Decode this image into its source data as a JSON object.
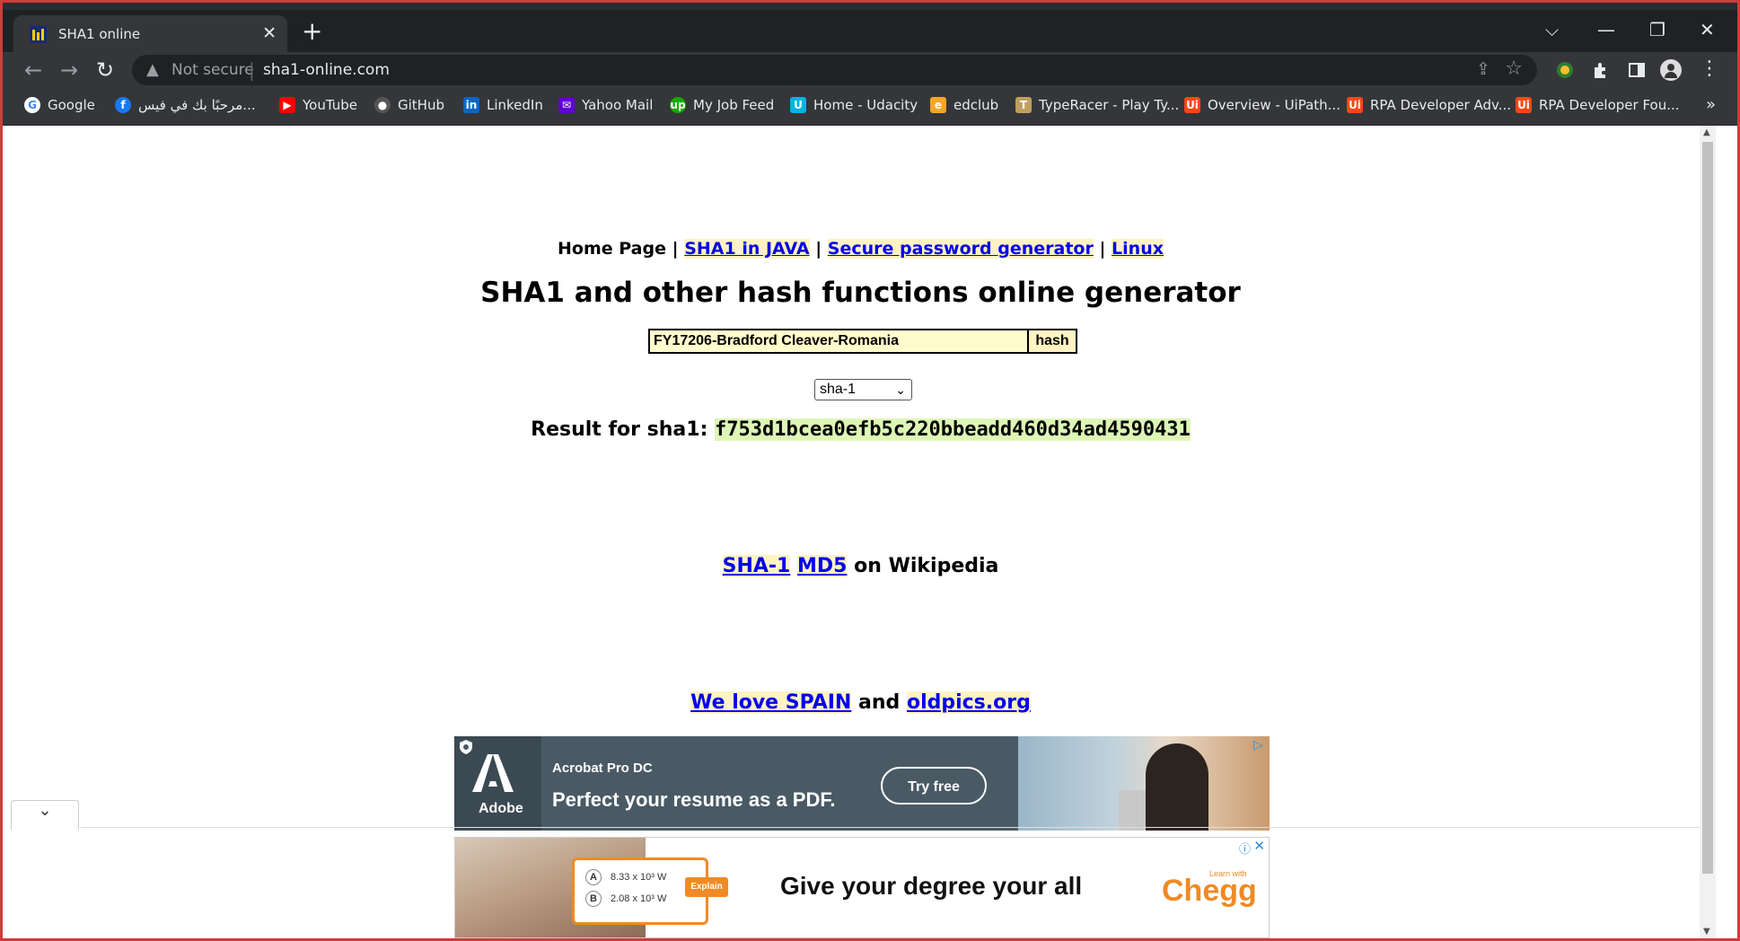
{
  "browser": {
    "tab_title": "SHA1 online",
    "new_tab": "+",
    "security_label": "Not secure",
    "url": "sha1-online.com"
  },
  "bookmarks": [
    {
      "label": "Google",
      "icon": "google-icon",
      "color": "#4285f4"
    },
    {
      "label": "مرحبًا بك في فيس...",
      "icon": "facebook-icon",
      "color": "#1877f2"
    },
    {
      "label": "YouTube",
      "icon": "youtube-icon",
      "color": "#ff0000"
    },
    {
      "label": "GitHub",
      "icon": "github-icon",
      "color": "#24292e"
    },
    {
      "label": "LinkedIn",
      "icon": "linkedin-icon",
      "color": "#0a66c2"
    },
    {
      "label": "Yahoo Mail",
      "icon": "yahoo-mail-icon",
      "color": "#6001d2"
    },
    {
      "label": "My Job Feed",
      "icon": "upwork-icon",
      "color": "#14a800"
    },
    {
      "label": "Home - Udacity",
      "icon": "udacity-icon",
      "color": "#02b3e4"
    },
    {
      "label": "edclub",
      "icon": "edclub-icon",
      "color": "#f5a623"
    },
    {
      "label": "TypeRacer - Play Ty...",
      "icon": "typeracer-icon",
      "color": "#c0a060"
    },
    {
      "label": "Overview - UiPath...",
      "icon": "uipath-icon",
      "color": "#fa4616"
    },
    {
      "label": "RPA Developer Adv...",
      "icon": "uipath-icon",
      "color": "#fa4616"
    },
    {
      "label": "RPA Developer Fou...",
      "icon": "uipath-icon",
      "color": "#fa4616"
    }
  ],
  "page": {
    "nav": {
      "home": "Home Page",
      "sep": "|",
      "links": [
        "SHA1 in JAVA",
        "Secure password generator",
        "Linux"
      ]
    },
    "title": "SHA1 and other hash functions online generator",
    "input_value": "FY17206-Bradford Cleaver-Romania",
    "hash_button": "hash",
    "algorithm": "sha-1",
    "result_label": "Result for sha1:",
    "result_value": "f753d1bcea0efb5c220bbeadd460d34ad4590431",
    "wiki": {
      "link1": "SHA-1",
      "link2": "MD5",
      "suffix": "on Wikipedia"
    },
    "spain": {
      "link1": "We love SPAIN",
      "middle": "and",
      "link2": "oldpics.org"
    }
  },
  "ads": {
    "adobe": {
      "brand": "Adobe",
      "product": "Acrobat Pro DC",
      "headline": "Perfect your resume as a PDF.",
      "cta": "Try free"
    },
    "chegg": {
      "optA_letter": "A",
      "optA": "8.33 x 10³ W",
      "optB_letter": "B",
      "optB": "2.08 x 10³ W",
      "explain": "Explain",
      "headline": "Give your degree your all",
      "learn": "Learn with",
      "brand": "Chegg"
    }
  }
}
